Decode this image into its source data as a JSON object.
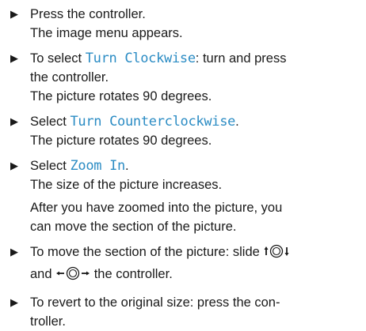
{
  "steps": [
    {
      "text": "Press the controller.",
      "result": "The image menu appears."
    },
    {
      "prefix": "To select ",
      "ui_term": "Turn Clockwise",
      "suffix_line1": ": turn and press",
      "line2": "the controller.",
      "result": "The picture rotates 90 degrees."
    },
    {
      "prefix": "Select ",
      "ui_term": "Turn Counterclockwise",
      "suffix": ".",
      "result": "The picture rotates 90 degrees."
    },
    {
      "prefix": "Select ",
      "ui_term": "Zoom In",
      "suffix": ".",
      "result": "The size of the picture increases.",
      "note_line1": "After you have zoomed into the picture, you",
      "note_line2": "can move the section of the picture."
    },
    {
      "line1_prefix": "To move the section of the picture: slide",
      "line2_and": "and",
      "line2_suffix": "the controller."
    },
    {
      "line1": "To revert to the original size: press the con-",
      "line2": "troller."
    }
  ],
  "bullet_glyph": "▶",
  "colors": {
    "text": "#1a1a1a",
    "ui_term": "#2b8cc4"
  }
}
